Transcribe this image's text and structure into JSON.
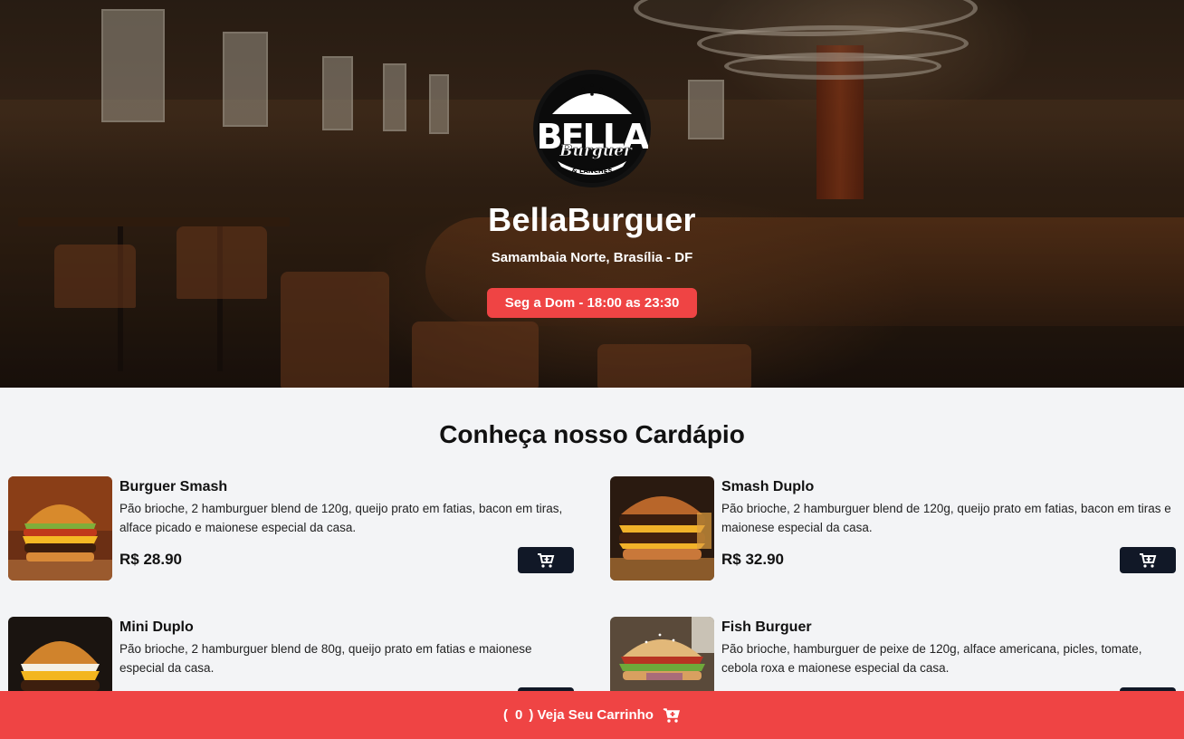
{
  "header": {
    "logo": {
      "text_main": "BELLA",
      "text_script": "Burguer",
      "text_sub": "& LANCHES"
    },
    "name": "BellaBurguer",
    "address": "Samambaia Norte, Brasília - DF",
    "hours": "Seg a Dom - 18:00 as 23:30"
  },
  "menu": {
    "title": "Conheça nosso Cardápio",
    "items": [
      {
        "name": "Burguer Smash",
        "description": "Pão brioche, 2 hamburguer blend de 120g, queijo prato em fatias, bacon em tiras, alface picado e maionese especial da casa.",
        "price": "R$ 28.90",
        "add_icon": "cart-plus-icon"
      },
      {
        "name": "Smash Duplo",
        "description": "Pão brioche, 2 hamburguer blend de 120g, queijo prato em fatias, bacon em tiras e maionese especial da casa.",
        "price": "R$ 32.90",
        "add_icon": "cart-plus-icon"
      },
      {
        "name": "Mini Duplo",
        "description": "Pão brioche, 2 hamburguer blend de 80g, queijo prato em fatias e maionese especial da casa.",
        "price": "",
        "add_icon": "cart-plus-icon"
      },
      {
        "name": "Fish Burguer",
        "description": "Pão brioche, hamburguer de peixe de 120g, alface americana, picles, tomate, cebola roxa e maionese especial da casa.",
        "price": "",
        "add_icon": "cart-plus-icon"
      }
    ]
  },
  "cart": {
    "count": "0",
    "label": ") Veja Seu Carrinho",
    "open_paren": "(",
    "icon": "cart-icon"
  },
  "colors": {
    "accent": "#ef4444",
    "button_dark": "#111827",
    "page_bg": "#f3f4f6"
  }
}
